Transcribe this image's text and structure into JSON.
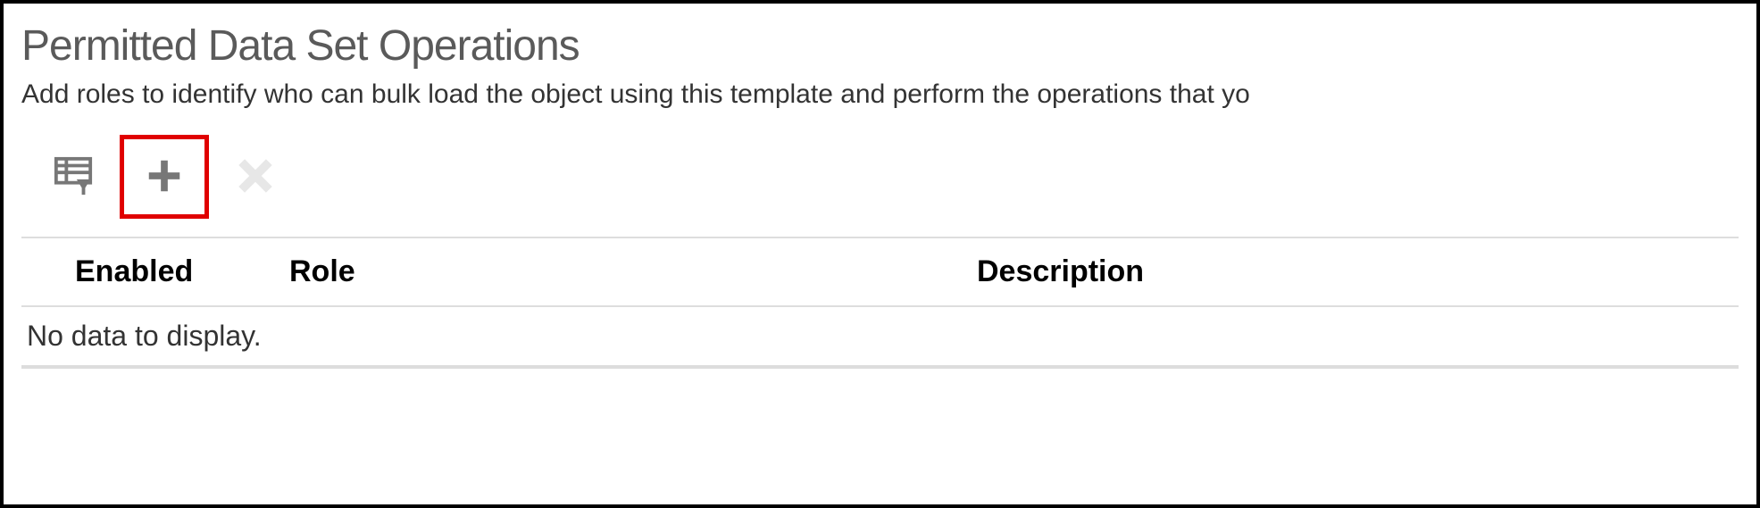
{
  "section": {
    "title": "Permitted Data Set Operations",
    "subtext": "Add roles to identify who can bulk load the object using this template and perform the operations that yo"
  },
  "toolbar": {
    "query_label": "Query",
    "add_label": "Add",
    "remove_label": "Remove"
  },
  "table": {
    "columns": {
      "enabled": "Enabled",
      "role": "Role",
      "description": "Description"
    },
    "empty_message": "No data to display.",
    "rows": []
  }
}
